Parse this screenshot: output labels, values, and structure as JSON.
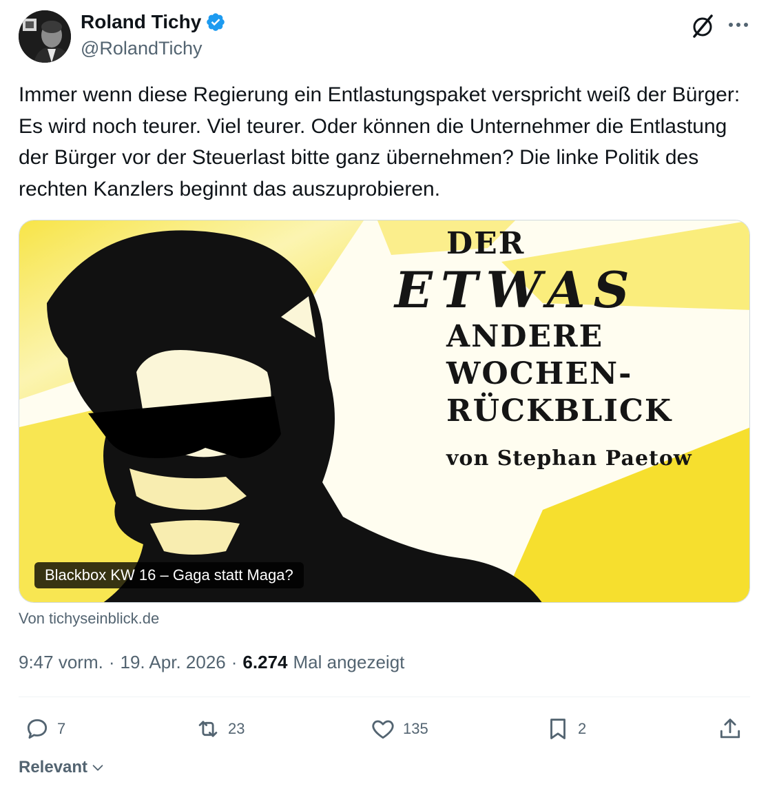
{
  "author": {
    "name": "Roland Tichy",
    "handle": "@RolandTichy"
  },
  "tweet": {
    "text": "Immer wenn diese Regierung ein Entlastungspaket verspricht weiß der Bürger: Es wird noch teurer. Viel teurer. Oder können die Unternehmer die Entlastung der Bürger vor der Steuerlast bitte ganz übernehmen? Die linke Politik des rechten Kanzlers beginnt das auszuprobieren."
  },
  "card": {
    "image_text": {
      "line1": "DER",
      "line2": "ETWAS",
      "line3": "ANDERE",
      "line4": "WOCHEN-",
      "line5": "RÜCKBLICK",
      "byline": "von Stephan Paetow"
    },
    "label": "Blackbox KW 16 – Gaga statt Maga?",
    "source": "Von tichyseinblick.de"
  },
  "meta": {
    "time": "9:47 vorm.",
    "sep1": "·",
    "date": "19. Apr. 2026",
    "sep2": "·",
    "views": "6.274",
    "views_label": "Mal angezeigt"
  },
  "actions": {
    "replies": "7",
    "reposts": "23",
    "likes": "135",
    "bookmarks": "2"
  },
  "sort": {
    "label": "Relevant"
  },
  "icons": [
    "verified-badge-icon",
    "grok-icon",
    "more-icon",
    "reply-icon",
    "repost-icon",
    "like-icon",
    "bookmark-icon",
    "share-icon",
    "chevron-down-icon"
  ],
  "colors": {
    "verified": "#1d9bf0",
    "secondary_text": "#536471",
    "card_yellow": "#f7e43a"
  }
}
